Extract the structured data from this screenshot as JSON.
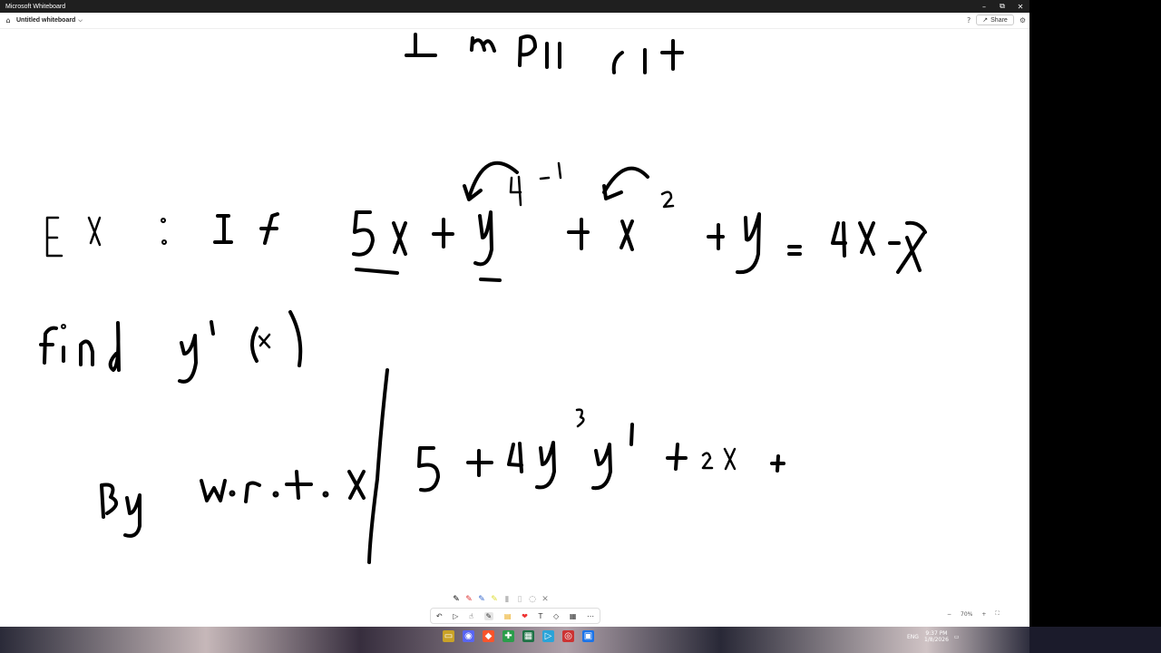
{
  "window": {
    "title": "Microsoft Whiteboard",
    "minimize": "–",
    "restore": "⧉",
    "close": "✕"
  },
  "header": {
    "home_icon": "⌂",
    "doc_name": "Untitled whiteboard",
    "chevron": "⌵",
    "help_icon": "?",
    "share_icon": "↗",
    "share_label": "Share",
    "settings_icon": "⚙"
  },
  "canvas": {
    "content": "handwritten math ink",
    "ink_text": [
      "Implicit",
      "Ex : If 5x + y^4 - 1 + x^2 + y = 4x - x",
      "find y'(x)",
      "By w.r.t.x | 5 + 4y^3 y' + 2x +"
    ]
  },
  "pens": [
    "✎",
    "✎",
    "✎",
    "✎",
    "▮",
    "▯",
    "◌",
    "✕"
  ],
  "toolbar": {
    "undo": "↶",
    "select": "▷",
    "touch": "☝",
    "pen": "✎",
    "notes": "▤",
    "reactions": "❤",
    "text": "T",
    "shapes": "◇",
    "templates": "▦",
    "more": "⋯"
  },
  "zoom": {
    "zoom_out": "−",
    "level": "70%",
    "zoom_in": "+",
    "fit": "⛶"
  },
  "taskbar": {
    "icons": [
      "▭",
      "◉",
      "◆",
      "✚",
      "▦",
      "▷",
      "◎",
      "▣"
    ],
    "lang": "ENG",
    "time": "9:37 PM",
    "date": "1/8/2026",
    "notify": "▭"
  }
}
